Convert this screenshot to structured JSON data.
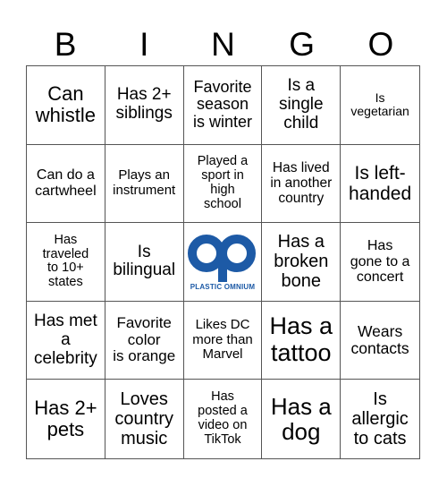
{
  "header": {
    "letters": [
      "B",
      "I",
      "N",
      "G",
      "O"
    ]
  },
  "brand_color": "#1d5aa6",
  "cells": [
    {
      "text": "Can\nwhistle",
      "size": 22
    },
    {
      "text": "Has 2+\nsiblings",
      "size": 19
    },
    {
      "text": "Favorite\nseason\nis winter",
      "size": 18
    },
    {
      "text": "Is a\nsingle\nchild",
      "size": 19
    },
    {
      "text": "Is\nvegetarian",
      "size": 14
    },
    {
      "text": "Can do a\ncartwheel",
      "size": 16
    },
    {
      "text": "Plays an\ninstrument",
      "size": 15
    },
    {
      "text": "Played a\nsport in\nhigh\nschool",
      "size": 14.5
    },
    {
      "text": "Has lived\nin another\ncountry",
      "size": 15.5
    },
    {
      "text": "Is left-\nhanded",
      "size": 21
    },
    {
      "text": "Has\ntraveled\nto 10+\nstates",
      "size": 14.5
    },
    {
      "text": "Is\nbilingual",
      "size": 19
    },
    {
      "free": true,
      "logo_text": "PLASTIC OMNIUM"
    },
    {
      "text": "Has a\nbroken\nbone",
      "size": 20
    },
    {
      "text": "Has\ngone to a\nconcert",
      "size": 16
    },
    {
      "text": "Has met\na\ncelebrity",
      "size": 19
    },
    {
      "text": "Favorite\ncolor\nis orange",
      "size": 17
    },
    {
      "text": "Likes DC\nmore than\nMarvel",
      "size": 15
    },
    {
      "text": "Has a\ntattoo",
      "size": 27
    },
    {
      "text": "Wears\ncontacts",
      "size": 17.5
    },
    {
      "text": "Has 2+\npets",
      "size": 22
    },
    {
      "text": "Loves\ncountry\nmusic",
      "size": 20
    },
    {
      "text": "Has\nposted a\nvideo on\nTikTok",
      "size": 14.5
    },
    {
      "text": "Has a\ndog",
      "size": 26
    },
    {
      "text": "Is\nallergic\nto cats",
      "size": 20
    }
  ]
}
